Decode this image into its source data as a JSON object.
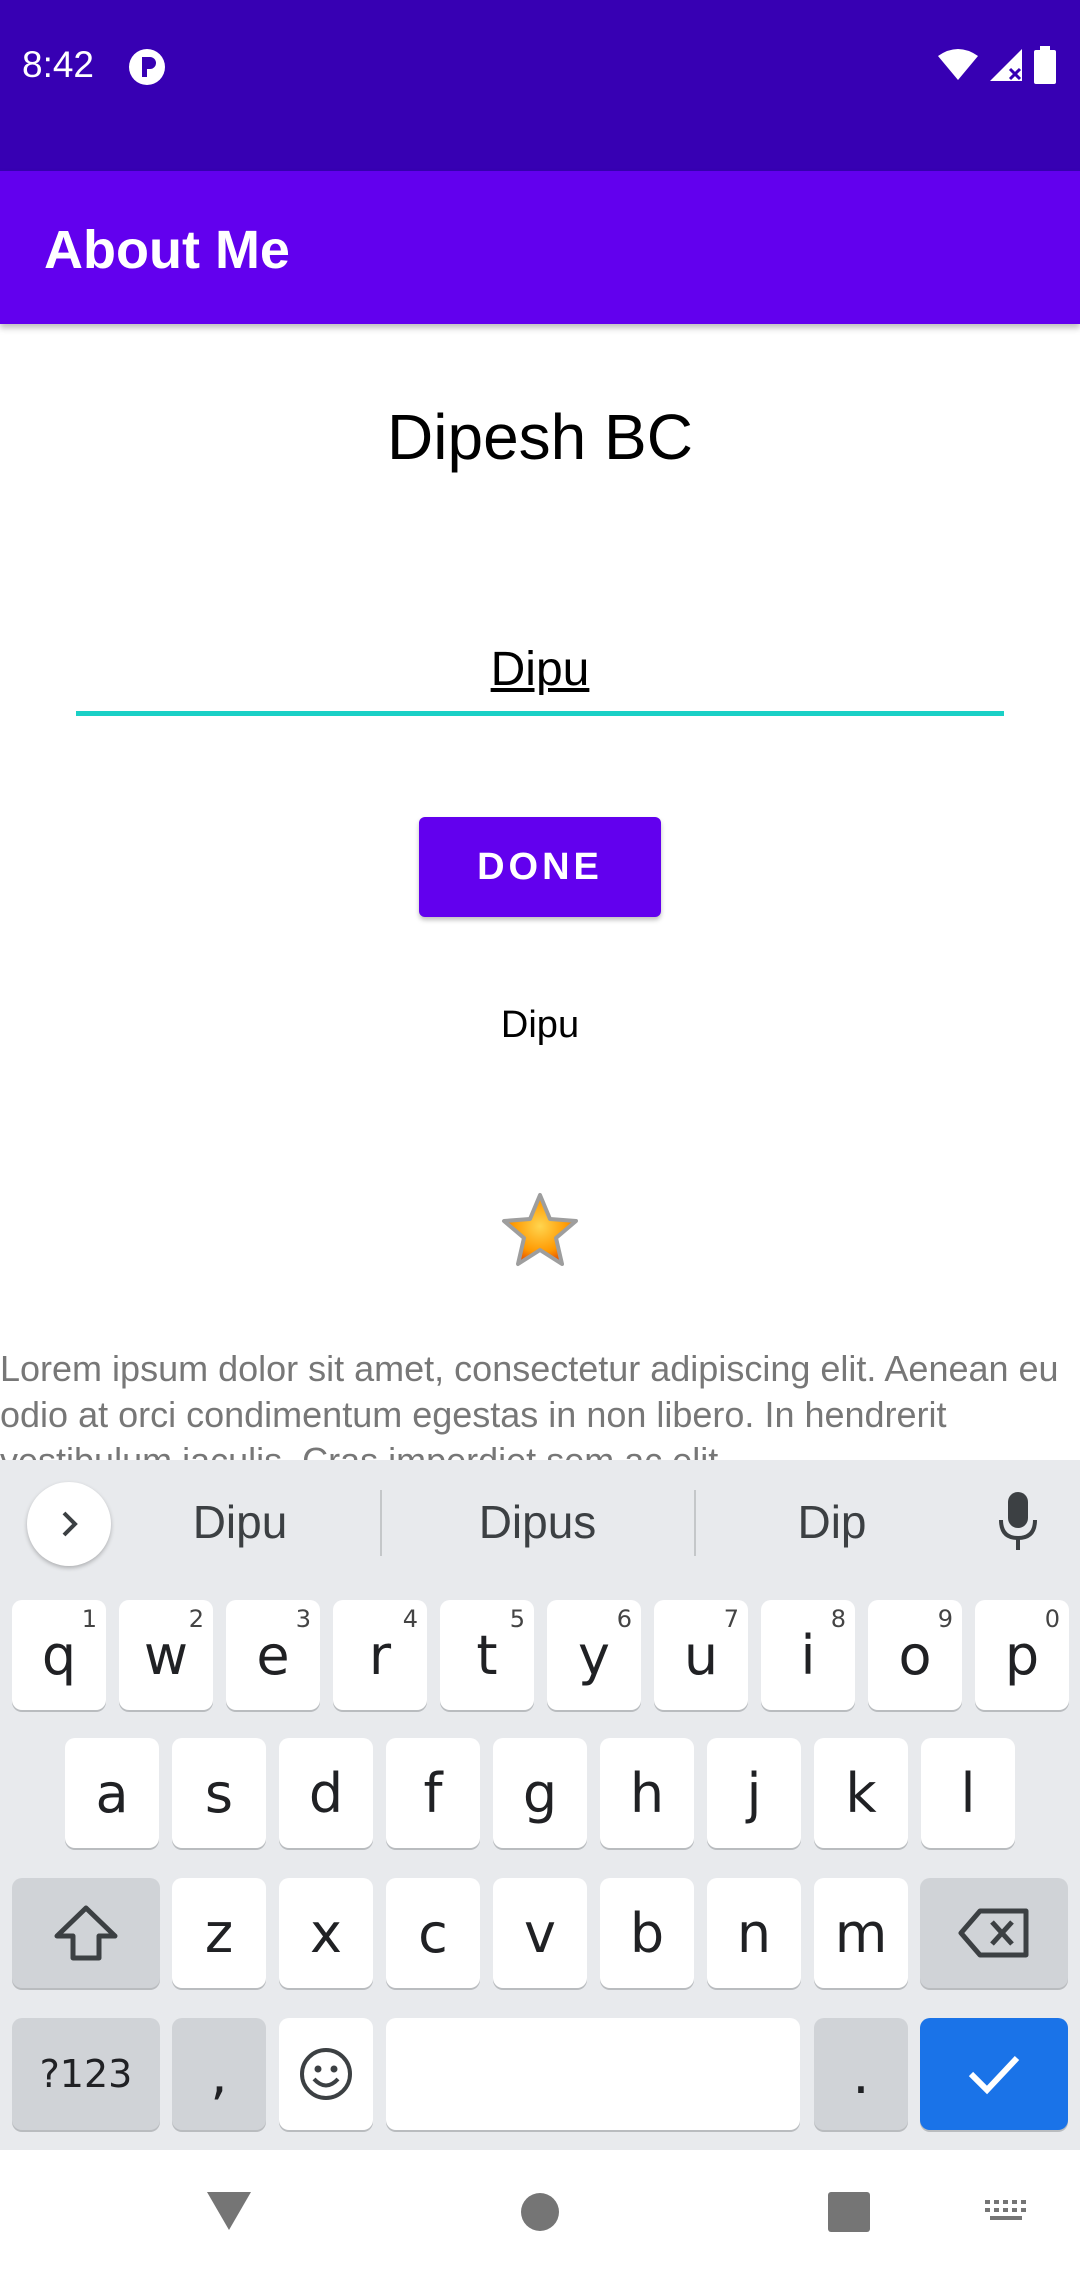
{
  "status_bar": {
    "time": "8:42"
  },
  "app_bar": {
    "title": "About Me"
  },
  "main": {
    "name": "Dipesh BC",
    "nickname_input_value": "Dipu",
    "done_label": "DONE",
    "nickname_text": "Dipu",
    "bio": "Lorem ipsum dolor sit amet, consectetur adipiscing elit. Aenean eu odio at orci condimentum egestas in non libero. In hendrerit vestibulum iaculis. Cras imperdiet sem ac elit"
  },
  "keyboard": {
    "suggestions": [
      "Dipu",
      "Dipus",
      "Dip"
    ],
    "row1": [
      {
        "key": "q",
        "hint": "1"
      },
      {
        "key": "w",
        "hint": "2"
      },
      {
        "key": "e",
        "hint": "3"
      },
      {
        "key": "r",
        "hint": "4"
      },
      {
        "key": "t",
        "hint": "5"
      },
      {
        "key": "y",
        "hint": "6"
      },
      {
        "key": "u",
        "hint": "7"
      },
      {
        "key": "i",
        "hint": "8"
      },
      {
        "key": "o",
        "hint": "9"
      },
      {
        "key": "p",
        "hint": "0"
      }
    ],
    "row2": [
      "a",
      "s",
      "d",
      "f",
      "g",
      "h",
      "j",
      "k",
      "l"
    ],
    "row3": [
      "z",
      "x",
      "c",
      "v",
      "b",
      "n",
      "m"
    ],
    "symbols_label": "?123",
    "comma_label": ",",
    "period_label": "."
  },
  "colors": {
    "status_bar": "#3700b3",
    "primary": "#6200ee",
    "accent_underline": "#1ad0c6",
    "enter_key": "#1a73e8"
  }
}
